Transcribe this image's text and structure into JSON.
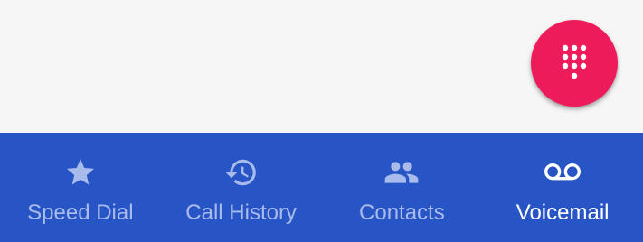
{
  "fab": {
    "icon": "dialpad-icon",
    "color": "#ee1b5a"
  },
  "bottom_nav": {
    "background": "#2855c6",
    "inactive_color": "#a9bbea",
    "active_color": "#ffffff",
    "items": [
      {
        "label": "Speed Dial",
        "icon": "star-icon",
        "active": false
      },
      {
        "label": "Call History",
        "icon": "history-icon",
        "active": false
      },
      {
        "label": "Contacts",
        "icon": "contacts-icon",
        "active": false
      },
      {
        "label": "Voicemail",
        "icon": "voicemail-icon",
        "active": true
      }
    ]
  }
}
